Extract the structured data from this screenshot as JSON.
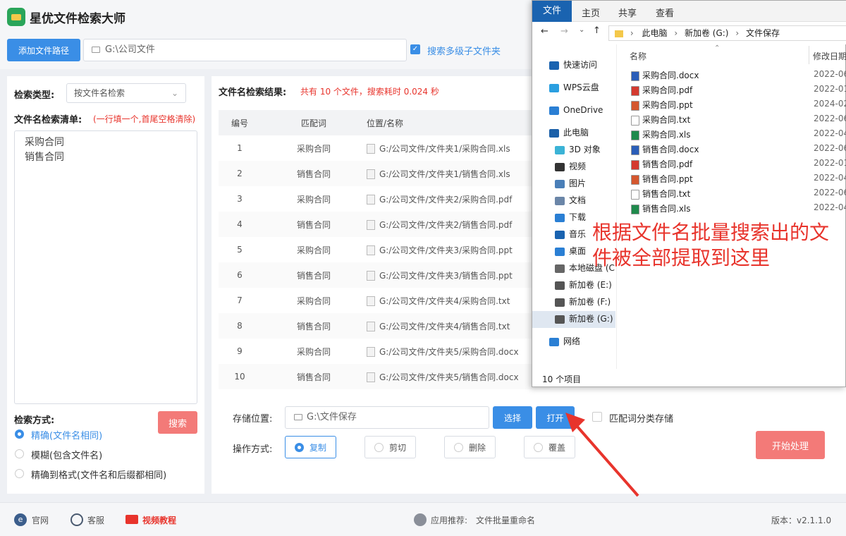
{
  "app": {
    "title": "星优文件检索大师"
  },
  "top": {
    "add_path_label": "添加文件路径",
    "path_value": "G:\\公司文件",
    "multi_level_label": "搜索多级子文件夹"
  },
  "left": {
    "search_type_label": "检索类型:",
    "search_type_value": "按文件名检索",
    "list_label": "文件名检索清单:",
    "list_hint": "(一行填一个,首尾空格清除)",
    "list_items": [
      "采购合同",
      "销售合同"
    ],
    "method_label": "检索方式:",
    "search_button": "搜索",
    "methods": [
      "精确(文件名相同)",
      "模糊(包含文件名)",
      "精确到格式(文件名和后缀都相同)"
    ],
    "selected_method": 0
  },
  "results": {
    "title": "文件名检索结果:",
    "summary": "共有 10 个文件，搜索耗时 0.024 秒",
    "headers": [
      "编号",
      "匹配词",
      "位置/名称"
    ],
    "rows": [
      [
        "1",
        "采购合同",
        "G:/公司文件/文件夹1/采购合同.xls"
      ],
      [
        "2",
        "销售合同",
        "G:/公司文件/文件夹1/销售合同.xls"
      ],
      [
        "3",
        "采购合同",
        "G:/公司文件/文件夹2/采购合同.pdf"
      ],
      [
        "4",
        "销售合同",
        "G:/公司文件/文件夹2/销售合同.pdf"
      ],
      [
        "5",
        "采购合同",
        "G:/公司文件/文件夹3/采购合同.ppt"
      ],
      [
        "6",
        "销售合同",
        "G:/公司文件/文件夹3/销售合同.ppt"
      ],
      [
        "7",
        "采购合同",
        "G:/公司文件/文件夹4/采购合同.txt"
      ],
      [
        "8",
        "销售合同",
        "G:/公司文件/文件夹4/销售合同.txt"
      ],
      [
        "9",
        "采购合同",
        "G:/公司文件/文件夹5/采购合同.docx"
      ],
      [
        "10",
        "销售合同",
        "G:/公司文件/文件夹5/销售合同.docx"
      ]
    ]
  },
  "storage": {
    "label": "存储位置:",
    "value": "G:\\文件保存",
    "choose_button": "选择",
    "open_button": "打开",
    "classify_label": "匹配词分类存储"
  },
  "operation": {
    "label": "操作方式:",
    "options": [
      "复制",
      "剪切",
      "删除",
      "覆盖"
    ],
    "selected": 0,
    "start_button": "开始处理"
  },
  "footer": {
    "site": "官网",
    "service": "客服",
    "video": "视频教程",
    "recommend_label": "应用推荐:",
    "recommend_value": "文件批量重命名",
    "version": "版本：v2.1.1.0"
  },
  "explorer": {
    "tabs": [
      "文件",
      "主页",
      "共享",
      "查看"
    ],
    "breadcrumb": [
      "此电脑",
      "新加卷 (G:)",
      "文件保存"
    ],
    "col_name": "名称",
    "col_date": "修改日期",
    "nav": [
      "快速访问",
      "WPS云盘",
      "OneDrive",
      "此电脑",
      "3D 对象",
      "视频",
      "图片",
      "文档",
      "下载",
      "音乐",
      "桌面",
      "本地磁盘 (C",
      "新加卷 (E:)",
      "新加卷 (F:)",
      "新加卷 (G:)",
      "网络"
    ],
    "files": [
      {
        "name": "采购合同.docx",
        "date": "2022-06",
        "type": "docx"
      },
      {
        "name": "采购合同.pdf",
        "date": "2022-01",
        "type": "pdf"
      },
      {
        "name": "采购合同.ppt",
        "date": "2024-02",
        "type": "ppt"
      },
      {
        "name": "采购合同.txt",
        "date": "2022-06",
        "type": "txt"
      },
      {
        "name": "采购合同.xls",
        "date": "2022-04",
        "type": "xls"
      },
      {
        "name": "销售合同.docx",
        "date": "2022-06",
        "type": "docx"
      },
      {
        "name": "销售合同.pdf",
        "date": "2022-01",
        "type": "pdf"
      },
      {
        "name": "销售合同.ppt",
        "date": "2022-04",
        "type": "ppt"
      },
      {
        "name": "销售合同.txt",
        "date": "2022-06",
        "type": "txt"
      },
      {
        "name": "销售合同.xls",
        "date": "2022-04",
        "type": "xls"
      }
    ],
    "status": "10 个项目"
  },
  "annotation": "根据文件名批量搜索出的文件被全部提取到这里",
  "colors": {
    "accent": "#3a8ee6",
    "danger": "#f37a78",
    "annotation": "#e8342c"
  }
}
